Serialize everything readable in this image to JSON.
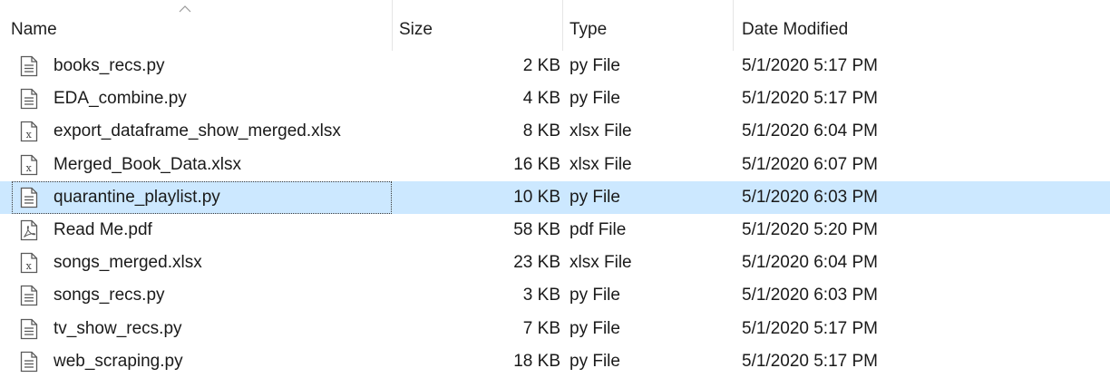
{
  "columns": {
    "name": "Name",
    "size": "Size",
    "type": "Type",
    "date": "Date Modified"
  },
  "sort": {
    "column": "name",
    "direction": "ascending"
  },
  "colors": {
    "selection": "#cce8ff",
    "text": "#1a1a1a"
  },
  "files": [
    {
      "name": "books_recs.py",
      "size": "2 KB",
      "type": "py File",
      "date": "5/1/2020 5:17 PM",
      "icon": "text-file-icon"
    },
    {
      "name": "EDA_combine.py",
      "size": "4 KB",
      "type": "py File",
      "date": "5/1/2020 5:17 PM",
      "icon": "text-file-icon"
    },
    {
      "name": "export_dataframe_show_merged.xlsx",
      "size": "8 KB",
      "type": "xlsx File",
      "date": "5/1/2020 6:04 PM",
      "icon": "excel-file-icon"
    },
    {
      "name": "Merged_Book_Data.xlsx",
      "size": "16 KB",
      "type": "xlsx File",
      "date": "5/1/2020 6:07 PM",
      "icon": "excel-file-icon"
    },
    {
      "name": "quarantine_playlist.py",
      "size": "10 KB",
      "type": "py File",
      "date": "5/1/2020 6:03 PM",
      "icon": "text-file-icon",
      "selected": true
    },
    {
      "name": "Read Me.pdf",
      "size": "58 KB",
      "type": "pdf File",
      "date": "5/1/2020 5:20 PM",
      "icon": "pdf-file-icon"
    },
    {
      "name": "songs_merged.xlsx",
      "size": "23 KB",
      "type": "xlsx File",
      "date": "5/1/2020 6:04 PM",
      "icon": "excel-file-icon"
    },
    {
      "name": "songs_recs.py",
      "size": "3 KB",
      "type": "py File",
      "date": "5/1/2020 6:03 PM",
      "icon": "text-file-icon"
    },
    {
      "name": "tv_show_recs.py",
      "size": "7 KB",
      "type": "py File",
      "date": "5/1/2020 5:17 PM",
      "icon": "text-file-icon"
    },
    {
      "name": "web_scraping.py",
      "size": "18 KB",
      "type": "py File",
      "date": "5/1/2020 5:17 PM",
      "icon": "text-file-icon"
    }
  ]
}
